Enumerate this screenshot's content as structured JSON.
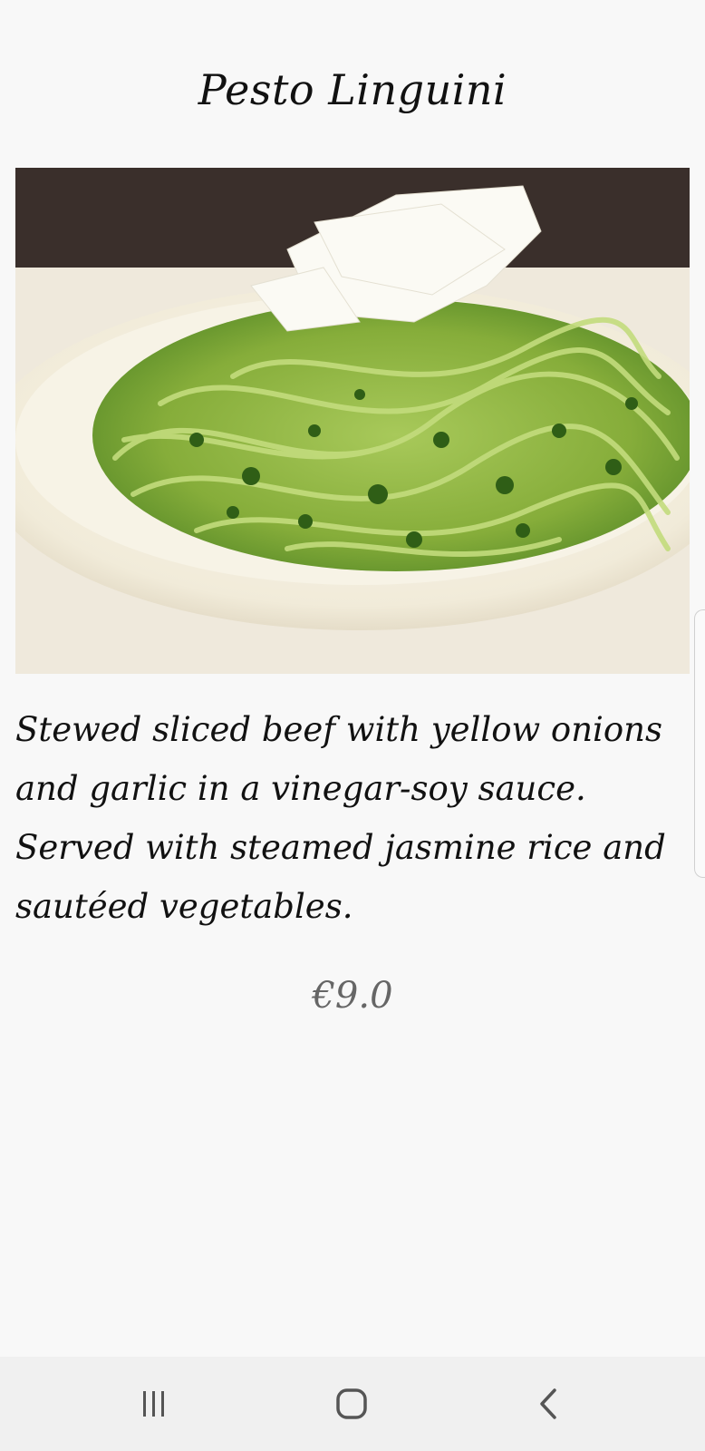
{
  "dish": {
    "title": "Pesto Linguini",
    "description": "Stewed sliced beef with yellow onions and garlic in a vinegar-soy sauce. Served with steamed jasmine rice and sautéed vegetables.",
    "price": "€9.0",
    "photo_subject": "bowl of pesto linguini topped with shaved parmesan"
  },
  "navbar": {
    "recent_icon": "recent-apps-icon",
    "home_icon": "home-icon",
    "back_icon": "back-icon"
  },
  "colors": {
    "background": "#f8f8f8",
    "text": "#111111",
    "price": "#666666",
    "navbar": "#f0f0f0",
    "pesto_green": "#5e8f2a"
  }
}
